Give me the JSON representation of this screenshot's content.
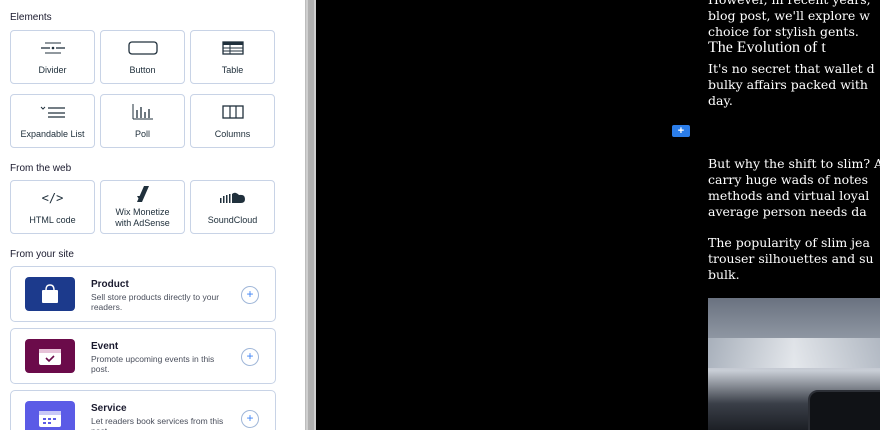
{
  "panel": {
    "sections": {
      "elements": "Elements",
      "from_web": "From the web",
      "from_site": "From your site"
    },
    "tiles": [
      {
        "label": "Divider",
        "icon": "divider-icon"
      },
      {
        "label": "Button",
        "icon": "button-icon"
      },
      {
        "label": "Table",
        "icon": "table-icon"
      },
      {
        "label": "Expandable List",
        "icon": "expandable-list-icon"
      },
      {
        "label": "Poll",
        "icon": "poll-icon"
      },
      {
        "label": "Columns",
        "icon": "columns-icon"
      },
      {
        "label": "HTML code",
        "icon": "code-icon"
      },
      {
        "label": "Wix Monetize with AdSense",
        "icon": "adsense-icon"
      },
      {
        "label": "SoundCloud",
        "icon": "soundcloud-icon"
      }
    ],
    "cards": [
      {
        "title": "Product",
        "desc": "Sell store products directly to your readers.",
        "color": "#1c3a8c",
        "icon": "shopping-bag-icon"
      },
      {
        "title": "Event",
        "desc": "Promote upcoming events in this post.",
        "color": "#6b0b4a",
        "icon": "calendar-check-icon"
      },
      {
        "title": "Service",
        "desc": "Let readers book services from this post.",
        "color": "#5b5be6",
        "icon": "calendar-icon"
      }
    ]
  },
  "canvas": {
    "add_button": "+",
    "article": {
      "lines_top": [
        "However, in recent years,",
        "blog post, we'll explore w",
        "choice for stylish gents."
      ],
      "heading": "The Evolution of t",
      "para1": [
        "It's no secret that wallet d",
        "bulky affairs packed with",
        "day."
      ],
      "para2": [
        "But why the shift to slim? A",
        "carry huge wads of notes",
        "methods and virtual loyal",
        "average person needs da"
      ],
      "para3": [
        "The popularity of slim jea",
        "trouser silhouettes and su",
        "bulk."
      ]
    }
  }
}
